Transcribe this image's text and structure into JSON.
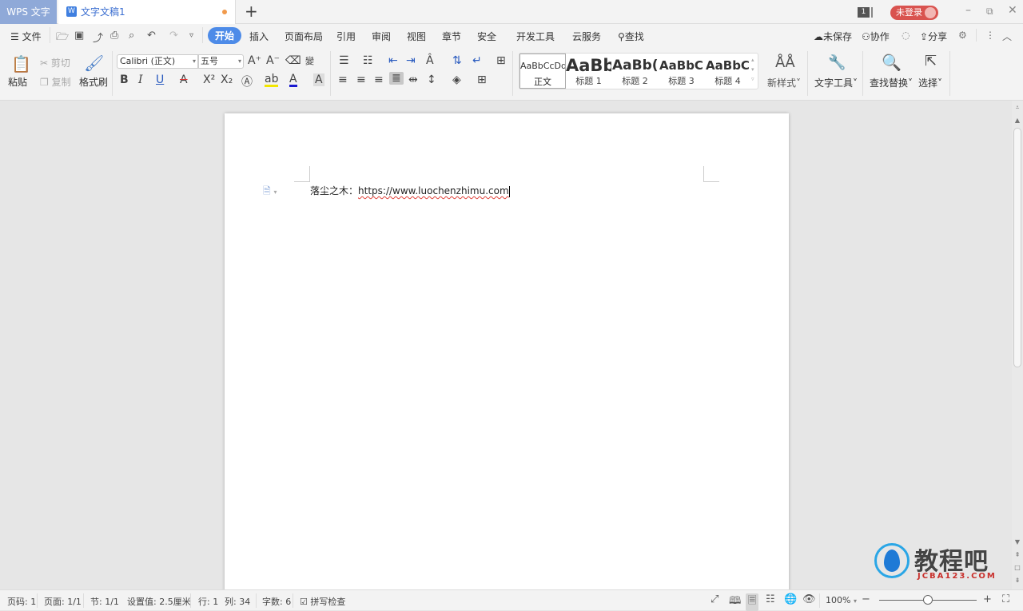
{
  "titlebar": {
    "app_tab": "WPS 文字",
    "doc_tab": "文字文稿1",
    "doc_icon": "W",
    "new_tab": "+",
    "page_count_badge": "1",
    "login_label": "未登录",
    "minimize": "–",
    "restore": "⧉",
    "close": "✕"
  },
  "menubar": {
    "file_label": "文件",
    "tabs": [
      {
        "label": "开始",
        "active": true
      },
      {
        "label": "插入"
      },
      {
        "label": "页面布局"
      },
      {
        "label": "引用"
      },
      {
        "label": "审阅"
      },
      {
        "label": "视图"
      },
      {
        "label": "章节"
      },
      {
        "label": "安全"
      },
      {
        "label": "开发工具"
      },
      {
        "label": "云服务"
      }
    ],
    "search_label": "查找",
    "right": {
      "unsaved": "未保存",
      "collab": "协作",
      "share": "分享"
    }
  },
  "ribbon": {
    "paste": "粘贴",
    "cut": "剪切",
    "copy": "复制",
    "format_painter": "格式刷",
    "font_name": "Calibri (正文)",
    "font_size": "五号",
    "styles": [
      {
        "preview": "AaBbCcDd",
        "name": "正文"
      },
      {
        "preview": "AaBb",
        "name": "标题 1"
      },
      {
        "preview": "AaBb(",
        "name": "标题 2"
      },
      {
        "preview": "AaBbC",
        "name": "标题 3"
      },
      {
        "preview": "AaBbC",
        "name": "标题 4"
      }
    ],
    "new_style": "新样式",
    "text_tools": "文字工具",
    "find_replace": "查找替换",
    "select": "选择"
  },
  "document": {
    "text_cn": "落尘之木：",
    "text_url": "https://www.luochenzhimu.com"
  },
  "statusbar": {
    "page_no": "页码: 1",
    "pages": "页面: 1/1",
    "section": "节: 1/1",
    "setting": "设置值: 2.5厘米",
    "row": "行: 1",
    "col": "列: 34",
    "word_count": "字数: 6",
    "spell_check": "拼写检查",
    "zoom": "100%",
    "zoom_fraction": 0.5
  },
  "watermark": {
    "title": "教程吧",
    "subtitle": "JCBA123.COM"
  }
}
